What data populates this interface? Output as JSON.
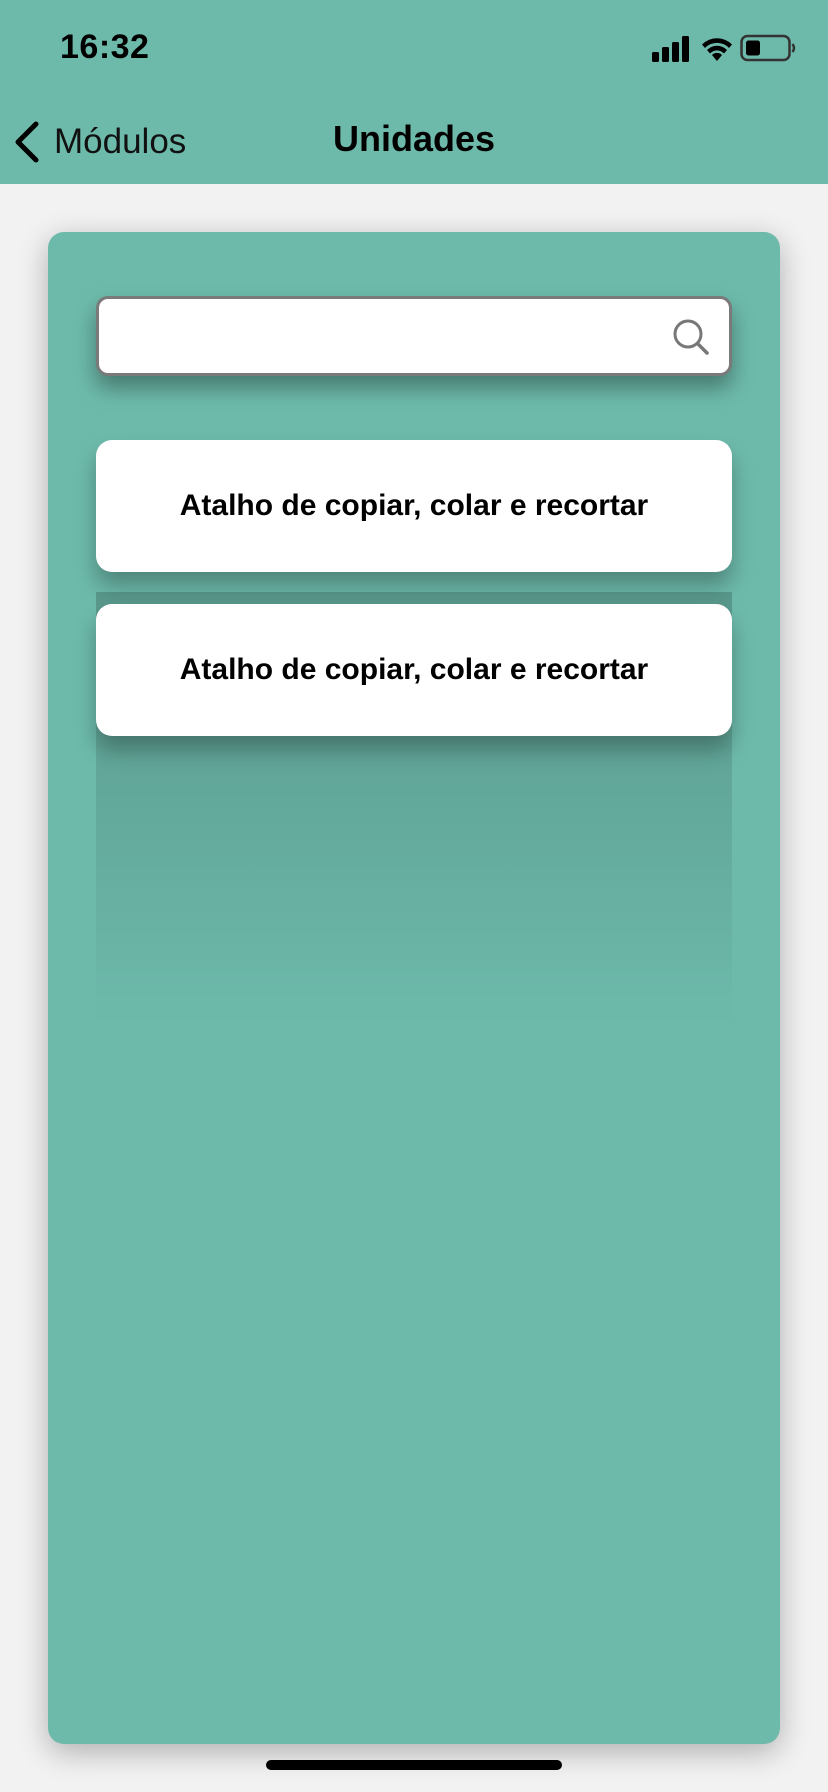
{
  "status_bar": {
    "time": "16:32"
  },
  "nav": {
    "back_label": "Módulos",
    "title": "Unidades"
  },
  "search": {
    "value": "",
    "placeholder": ""
  },
  "units": [
    {
      "label": "Atalho de copiar, colar e recortar"
    },
    {
      "label": "Atalho de copiar, colar e recortar"
    }
  ],
  "colors": {
    "accent": "#6dbaab",
    "background": "#f2f2f2",
    "card": "#ffffff"
  },
  "icons": [
    "signal-icon",
    "wifi-icon",
    "battery-icon",
    "chevron-left-icon",
    "search-icon"
  ]
}
